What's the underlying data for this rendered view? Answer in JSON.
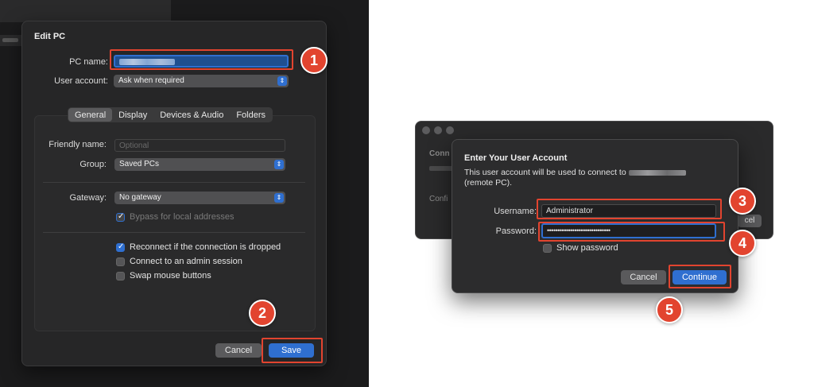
{
  "background": {
    "left_color": "#1b1b1c",
    "right_color": "#ffffff"
  },
  "edit_pc": {
    "title": "Edit PC",
    "pc_name_label": "PC name:",
    "user_account_label": "User account:",
    "user_account_value": "Ask when required",
    "tabs": [
      {
        "label": "General",
        "active": true
      },
      {
        "label": "Display",
        "active": false
      },
      {
        "label": "Devices & Audio",
        "active": false
      },
      {
        "label": "Folders",
        "active": false
      }
    ],
    "friendly_name_label": "Friendly name:",
    "friendly_name_placeholder": "Optional",
    "group_label": "Group:",
    "group_value": "Saved PCs",
    "gateway_label": "Gateway:",
    "gateway_value": "No gateway",
    "bypass_label": "Bypass for local addresses",
    "checkboxes": [
      {
        "label": "Reconnect if the connection is dropped",
        "checked": true
      },
      {
        "label": "Connect to an admin session",
        "checked": false
      },
      {
        "label": "Swap mouse buttons",
        "checked": false
      }
    ],
    "cancel_label": "Cancel",
    "save_label": "Save"
  },
  "rdp_window": {
    "behind_title_fragment": "Conn",
    "behind_label_fragment": "Confi",
    "behind_button_fragment": "cel"
  },
  "account_dialog": {
    "title": "Enter Your User Account",
    "description_line1": "This user account will be used to connect to",
    "description_line2": "(remote PC).",
    "username_label": "Username:",
    "username_value": "Administrator",
    "password_label": "Password:",
    "password_value": "••••••••••••••••••••••••••••••",
    "show_password_label": "Show password",
    "cancel_label": "Cancel",
    "continue_label": "Continue"
  },
  "annotations": {
    "color": "#e2442f",
    "steps": [
      "1",
      "2",
      "3",
      "4",
      "5"
    ]
  },
  "colors": {
    "accent": "#2f6fd0",
    "dialog_bg": "#262627"
  }
}
